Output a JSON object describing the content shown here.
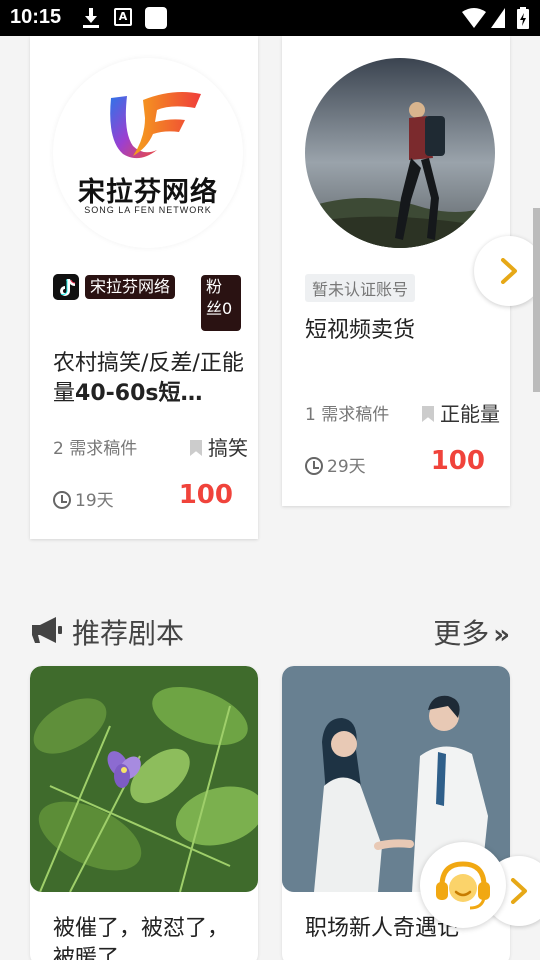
{
  "status_bar": {
    "time": "10:15"
  },
  "creators": [
    {
      "logo_text": "宋拉芬网络",
      "logo_sub": "SONG LA FEN NETWORK",
      "platform_icon": "tiktok-icon",
      "account_name": "宋拉芬网络",
      "fans_label": "粉丝0",
      "title_prefix": "农村搞笑/反差/正能量",
      "title_bold": "40-60s短…",
      "drafts": "2 需求稿件",
      "category": "搞笑",
      "days": "19天",
      "price": "100"
    },
    {
      "verify_badge": "暂未认证账号",
      "title": "短视频卖货",
      "drafts": "1 需求稿件",
      "category": "正能量",
      "days": "29天",
      "price": "100"
    }
  ],
  "section": {
    "title": "推荐剧本",
    "more": "更多"
  },
  "scripts": [
    {
      "title": "被催了，被怼了，被暖了"
    },
    {
      "title": "职场新人奇遇记"
    }
  ],
  "colors": {
    "price": "#f0433b",
    "accent": "#e6a817"
  }
}
